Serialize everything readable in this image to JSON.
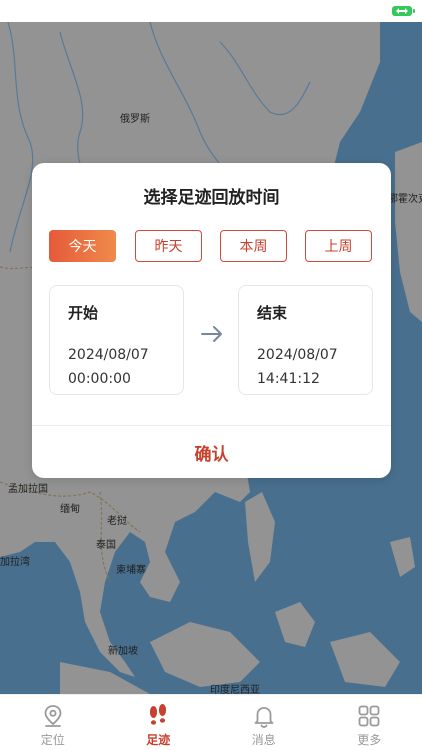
{
  "map": {
    "labels": [
      "俄罗斯",
      "孟加拉国",
      "缅甸",
      "老挝",
      "泰国",
      "柬埔寨",
      "加拉湾",
      "新加坡",
      "印度尼西亚",
      "鄂霍次克"
    ]
  },
  "dialog": {
    "title": "选择足迹回放时间",
    "quick_ranges": [
      {
        "label": "今天",
        "active": true
      },
      {
        "label": "昨天",
        "active": false
      },
      {
        "label": "本周",
        "active": false
      },
      {
        "label": "上周",
        "active": false
      }
    ],
    "start": {
      "label": "开始",
      "date": "2024/08/07",
      "time": "00:00:00"
    },
    "end": {
      "label": "结束",
      "date": "2024/08/07",
      "time": "14:41:12"
    },
    "confirm_label": "确认"
  },
  "tabbar": {
    "items": [
      {
        "label": "定位",
        "icon": "location-pin-icon",
        "active": false
      },
      {
        "label": "足迹",
        "icon": "footprints-icon",
        "active": true
      },
      {
        "label": "消息",
        "icon": "bell-icon",
        "active": false
      },
      {
        "label": "更多",
        "icon": "grid-icon",
        "active": false
      }
    ]
  },
  "colors": {
    "accent": "#c7412f",
    "accent_gradient_start": "#e55a3a",
    "accent_gradient_end": "#ef8b4a",
    "sea": "#5d8fb7",
    "land": "#bdbdbd",
    "battery": "#34c759"
  }
}
